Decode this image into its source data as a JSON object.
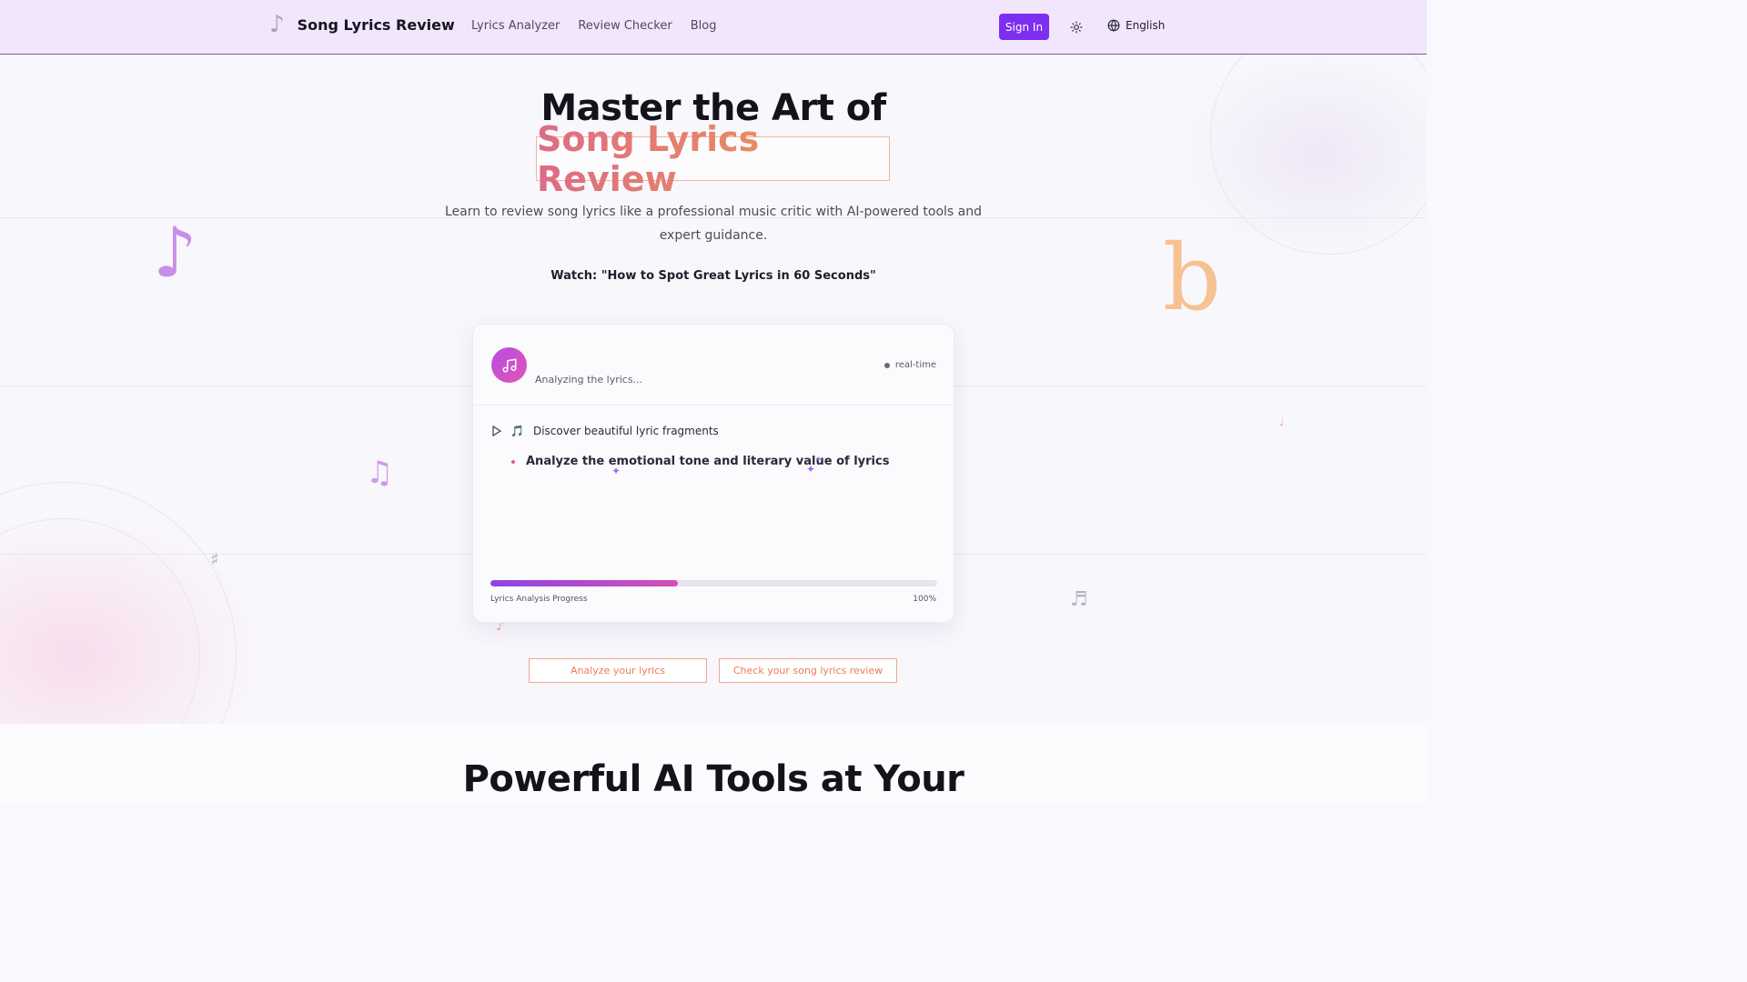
{
  "header": {
    "brand_title": "Song Lyrics Review",
    "brand_icon": "music-note-icon",
    "nav": [
      "Lyrics Analyzer",
      "Review Checker",
      "Blog"
    ],
    "sign_in": "Sign In",
    "theme_icon": "sun-icon",
    "language": "English",
    "language_icon": "globe-icon"
  },
  "hero": {
    "title_line1": "Master the Art of",
    "title_highlight": "Song Lyrics Review",
    "subtitle": "Learn to review song lyrics like a professional music critic with AI-powered tools and expert guidance.",
    "watch": "Watch: \"How to Spot Great Lyrics in 60 Seconds\""
  },
  "decorations": {
    "note_purple": "♪",
    "flat_orange": "b",
    "beamed_notes": "♫",
    "sharp": "♯",
    "small_note": "♬",
    "tiny_note": "♩"
  },
  "card": {
    "avatar_icon": "music-icon",
    "status": "Analyzing the lyrics...",
    "realtime": "real-time",
    "row1_emoji": "🎵",
    "row1": "Discover beautiful lyric fragments",
    "row2": "Analyze the emotional tone and literary value of lyrics",
    "progress_label": "Lyrics Analysis Progress",
    "progress_pct": "100%",
    "progress_fill": 0.42
  },
  "ctas": {
    "analyze": "Analyze your lyrics",
    "check": "Check your song lyrics review"
  },
  "section2": {
    "title": "Powerful AI Tools at Your"
  },
  "colors": {
    "accent": "#7d2ef0",
    "header_bg": "#f1e6fc",
    "highlight_start": "#dc6c86",
    "highlight_end": "#ef9d4a"
  }
}
